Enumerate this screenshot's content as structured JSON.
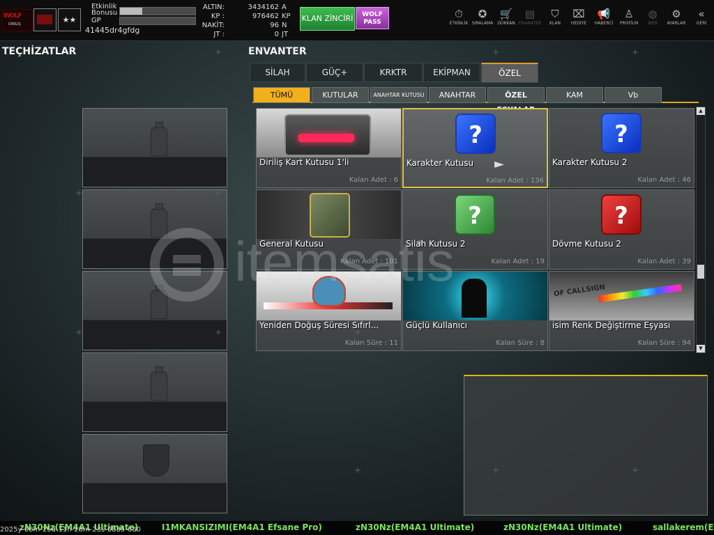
{
  "topbar": {
    "rank_badge": "★★",
    "logo_text": "WOLF",
    "logo_sub": "DİRİLİŞ",
    "event_bonus_label": "Etkinlik\nBonusu",
    "event_bonus_fill": 0.3,
    "gp_label": "GP",
    "gp_fill": 0,
    "username": "41445dr4gfdg",
    "currencies": [
      {
        "label": "ALTIN:",
        "value": "3434162",
        "unit": "A"
      },
      {
        "label": "KP :",
        "value": "976462",
        "unit": "KP"
      },
      {
        "label": "NAKİT:",
        "value": "96",
        "unit": "N"
      },
      {
        "label": "JT :",
        "value": "0",
        "unit": "JT"
      }
    ],
    "klan_button": "KLAN ZİNCİRİ",
    "wolf_pass_button": "WOLF PASS",
    "nav": [
      {
        "label": "ETKİNLİK",
        "icon": "stopwatch-icon",
        "glyph": "⏱"
      },
      {
        "label": "SIRALAMA",
        "icon": "medal-icon",
        "glyph": "✪"
      },
      {
        "label": "DÜKKAN",
        "icon": "cart-icon",
        "glyph": "🛒"
      },
      {
        "label": "ENVANTER",
        "icon": "inventory-icon",
        "glyph": "▤"
      },
      {
        "label": "KLAN",
        "icon": "klan-shield-icon",
        "glyph": "⛉"
      },
      {
        "label": "HEDİYE",
        "icon": "gift-icon",
        "glyph": "⌧"
      },
      {
        "label": "HABERCİ",
        "icon": "megaphone-icon",
        "glyph": "📢"
      },
      {
        "label": "PROFİLM",
        "icon": "profile-icon",
        "glyph": "♙"
      },
      {
        "label": "WEB",
        "icon": "globe-icon",
        "glyph": "◍"
      },
      {
        "label": "AYARLAR",
        "icon": "gear-icon",
        "glyph": "⚙"
      },
      {
        "label": "GERİ",
        "icon": "back-chevron-icon",
        "glyph": "«"
      }
    ]
  },
  "equipment": {
    "title": "TEÇHİZATLAR"
  },
  "inventory": {
    "title": "ENVANTER",
    "tabs": [
      "SİLAH",
      "GÜÇ+",
      "KRKTR",
      "EKİPMAN",
      "ÖZEL"
    ],
    "active_tab": "ÖZEL",
    "subtabs": [
      "TÜMÜ",
      "KUTULAR",
      "ANAHTAR KUTUSU",
      "ANAHTAR",
      "ÖZEL EŞYALAR",
      "KAM",
      "Vb"
    ],
    "active_subtab": "TÜMÜ",
    "items": [
      {
        "name": "Diriliş Kart Kutusu 1'li",
        "count": "Kalan Adet : 6"
      },
      {
        "name": "Karakter Kutusu",
        "count": "Kalan Adet : 136",
        "selected": true
      },
      {
        "name": "Karakter Kutusu 2",
        "count": "Kalan Adet : 46"
      },
      {
        "name": "General Kutusu",
        "count": "Kalan Adet : 101"
      },
      {
        "name": "Silah Kutusu 2",
        "count": "Kalan Adet : 19"
      },
      {
        "name": "Dövme Kutusu 2",
        "count": "Kalan Adet : 39"
      },
      {
        "name": "Yeniden Doğuş Süresi Sıfırl...",
        "count": "Kalan Süre : 11"
      },
      {
        "name": "Güçlü Kullanıcı",
        "count": "Kalan Süre : 8"
      },
      {
        "name": "isim Renk Değiştirme Eşyası",
        "count": "Kalan Süre : 94"
      }
    ],
    "cube_mark": "?",
    "callsign_text": "OF CALLSIGN"
  },
  "ticker": {
    "timestamp": "2025y-08m-25d-11h-28m-23s-0885-680",
    "messages": [
      "zN30Nz(EM4A1 Ultimate)",
      "I1MKANSIZIMI(EM4A1 Efsane Pro)",
      "zN30Nz(EM4A1 Ultimate)",
      "zN30Nz(EM4A1 Ultimate)",
      "sallakerem(EM"
    ]
  },
  "watermark": {
    "text": "itemsatis"
  },
  "colors": {
    "accent": "#f2b01c",
    "selected_border": "#e4c140",
    "ticker_green": "#7ae35b",
    "klan_green": "#2fa13f",
    "wolf_purple": "#a040b8"
  }
}
